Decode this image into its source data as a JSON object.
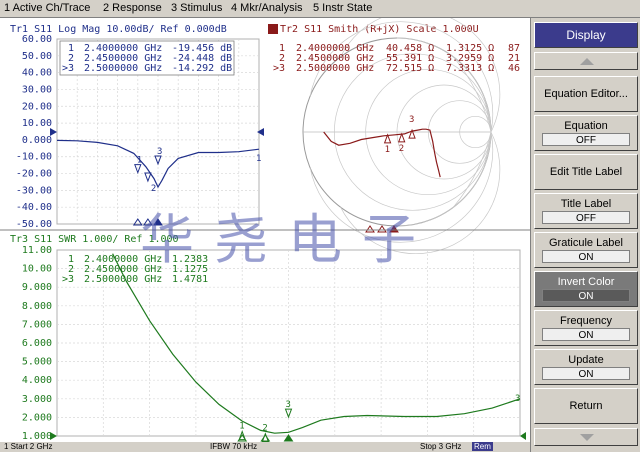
{
  "menu": [
    "1 Active Ch/Trace",
    "2 Response",
    "3 Stimulus",
    "4 Mkr/Analysis",
    "5 Instr State"
  ],
  "colors": {
    "trace1": "#1f2f8a",
    "trace2": "#8a1a1a",
    "trace3": "#1e7a1e",
    "softkey_selected": "#3b3b8c"
  },
  "tr1": {
    "title": "Tr1  S11  Log Mag 10.00dB/ Ref 0.000dB",
    "ytick_labels": [
      "60.00",
      "50.00",
      "40.00",
      "30.00",
      "20.00",
      "10.00",
      "0.000",
      "-10.00",
      "-20.00",
      "-30.00",
      "-40.00",
      "-50.00"
    ],
    "markers": [
      {
        "num": "1",
        "freq": "2.4000000 GHz",
        "value": "-19.456 dB"
      },
      {
        "num": "2",
        "freq": "2.4500000 GHz",
        "value": "-24.448 dB"
      },
      {
        "num": ">3",
        "freq": "2.5000000 GHz",
        "value": "-14.292 dB"
      }
    ],
    "chart_data": {
      "type": "line",
      "ylim": [
        -50,
        60
      ],
      "x_normalized": [
        0,
        0.1,
        0.2,
        0.3,
        0.38,
        0.44,
        0.48,
        0.5,
        0.52,
        0.55,
        0.6,
        0.7,
        0.8,
        0.9,
        1.0
      ],
      "values": [
        -0.3,
        -0.5,
        -1.5,
        -3.5,
        -8,
        -16,
        -23,
        -28,
        -24,
        -17,
        -11,
        -7.5,
        -7.5,
        -7,
        -5.5
      ],
      "marker_values": [
        -19.456,
        -24.448,
        -14.292
      ]
    }
  },
  "tr2": {
    "title": "Tr2  S11  Smith (R+jX)  Scale 1.000U",
    "markers": [
      {
        "num": "1",
        "freq": "2.4000000 GHz",
        "r": "40.458 Ω",
        "x": "1.3125 Ω",
        "extra": "87"
      },
      {
        "num": "2",
        "freq": "2.4500000 GHz",
        "r": "55.391 Ω",
        "x": "3.2959 Ω",
        "extra": "21"
      },
      {
        "num": ">3",
        "freq": "2.5000000 GHz",
        "r": "72.515 Ω",
        "x": "7.3313 Ω",
        "extra": "46"
      }
    ],
    "chart_data": {
      "type": "line",
      "gamma_real": [
        -0.78,
        -0.7,
        -0.62,
        -0.5,
        -0.38,
        -0.26,
        -0.14,
        -0.02,
        0.08,
        0.16,
        0.22,
        0.27,
        0.31,
        0.35,
        0.38,
        0.4,
        0.42,
        0.44,
        0.46
      ],
      "gamma_imag": [
        0.0,
        -0.1,
        -0.14,
        -0.12,
        -0.08,
        -0.06,
        -0.04,
        -0.03,
        -0.02,
        0.01,
        0.02,
        0.03,
        0.03,
        0.02,
        -0.1,
        -0.22,
        -0.32,
        -0.4,
        -0.48
      ],
      "marker_real": [
        -0.1,
        0.05,
        0.16
      ],
      "marker_imag": [
        -0.03,
        -0.02,
        0.02
      ]
    }
  },
  "tr3": {
    "title": "Tr3  S11  SWR 1.000/ Ref 1.000",
    "ytick_labels": [
      "11.00",
      "10.00",
      "9.000",
      "8.000",
      "7.000",
      "6.000",
      "5.000",
      "4.000",
      "3.000",
      "2.000",
      "1.000"
    ],
    "markers": [
      {
        "num": "1",
        "freq": "2.4000000 GHz",
        "value": "1.2383"
      },
      {
        "num": "2",
        "freq": "2.4500000 GHz",
        "value": "1.1275"
      },
      {
        "num": ">3",
        "freq": "2.5000000 GHz",
        "value": "1.4781"
      }
    ],
    "chart_data": {
      "type": "line",
      "ylim": [
        1,
        11
      ],
      "x_normalized": [
        0.12,
        0.15,
        0.2,
        0.25,
        0.3,
        0.35,
        0.4,
        0.44,
        0.47,
        0.5,
        0.53,
        0.57,
        0.62,
        0.67,
        0.75,
        0.82,
        0.88,
        0.94,
        1.0
      ],
      "values": [
        10.8,
        9.3,
        7.2,
        5.4,
        3.9,
        2.7,
        1.8,
        1.3,
        1.15,
        1.2,
        1.45,
        1.85,
        2.05,
        2.1,
        2.05,
        2.05,
        2.2,
        2.5,
        3.0
      ],
      "marker_values": [
        1.2383,
        1.1275,
        1.4781
      ]
    }
  },
  "softkeys": {
    "display": "Display",
    "equation_editor": "Equation Editor...",
    "equation": {
      "label": "Equation",
      "value": "OFF"
    },
    "edit_title": "Edit Title Label",
    "title_label": {
      "label": "Title Label",
      "value": "OFF"
    },
    "graticule_label": {
      "label": "Graticule Label",
      "value": "ON"
    },
    "invert_color": {
      "label": "Invert Color",
      "value": "ON"
    },
    "frequency": {
      "label": "Frequency",
      "value": "ON"
    },
    "update": {
      "label": "Update",
      "value": "ON"
    },
    "return": "Return"
  },
  "status": {
    "start": "1  Start 2 GHz",
    "ifbw": "IFBW 70 kHz",
    "stop": "Stop 3 GHz",
    "rem": "Rem"
  },
  "watermark": "华尧电子"
}
